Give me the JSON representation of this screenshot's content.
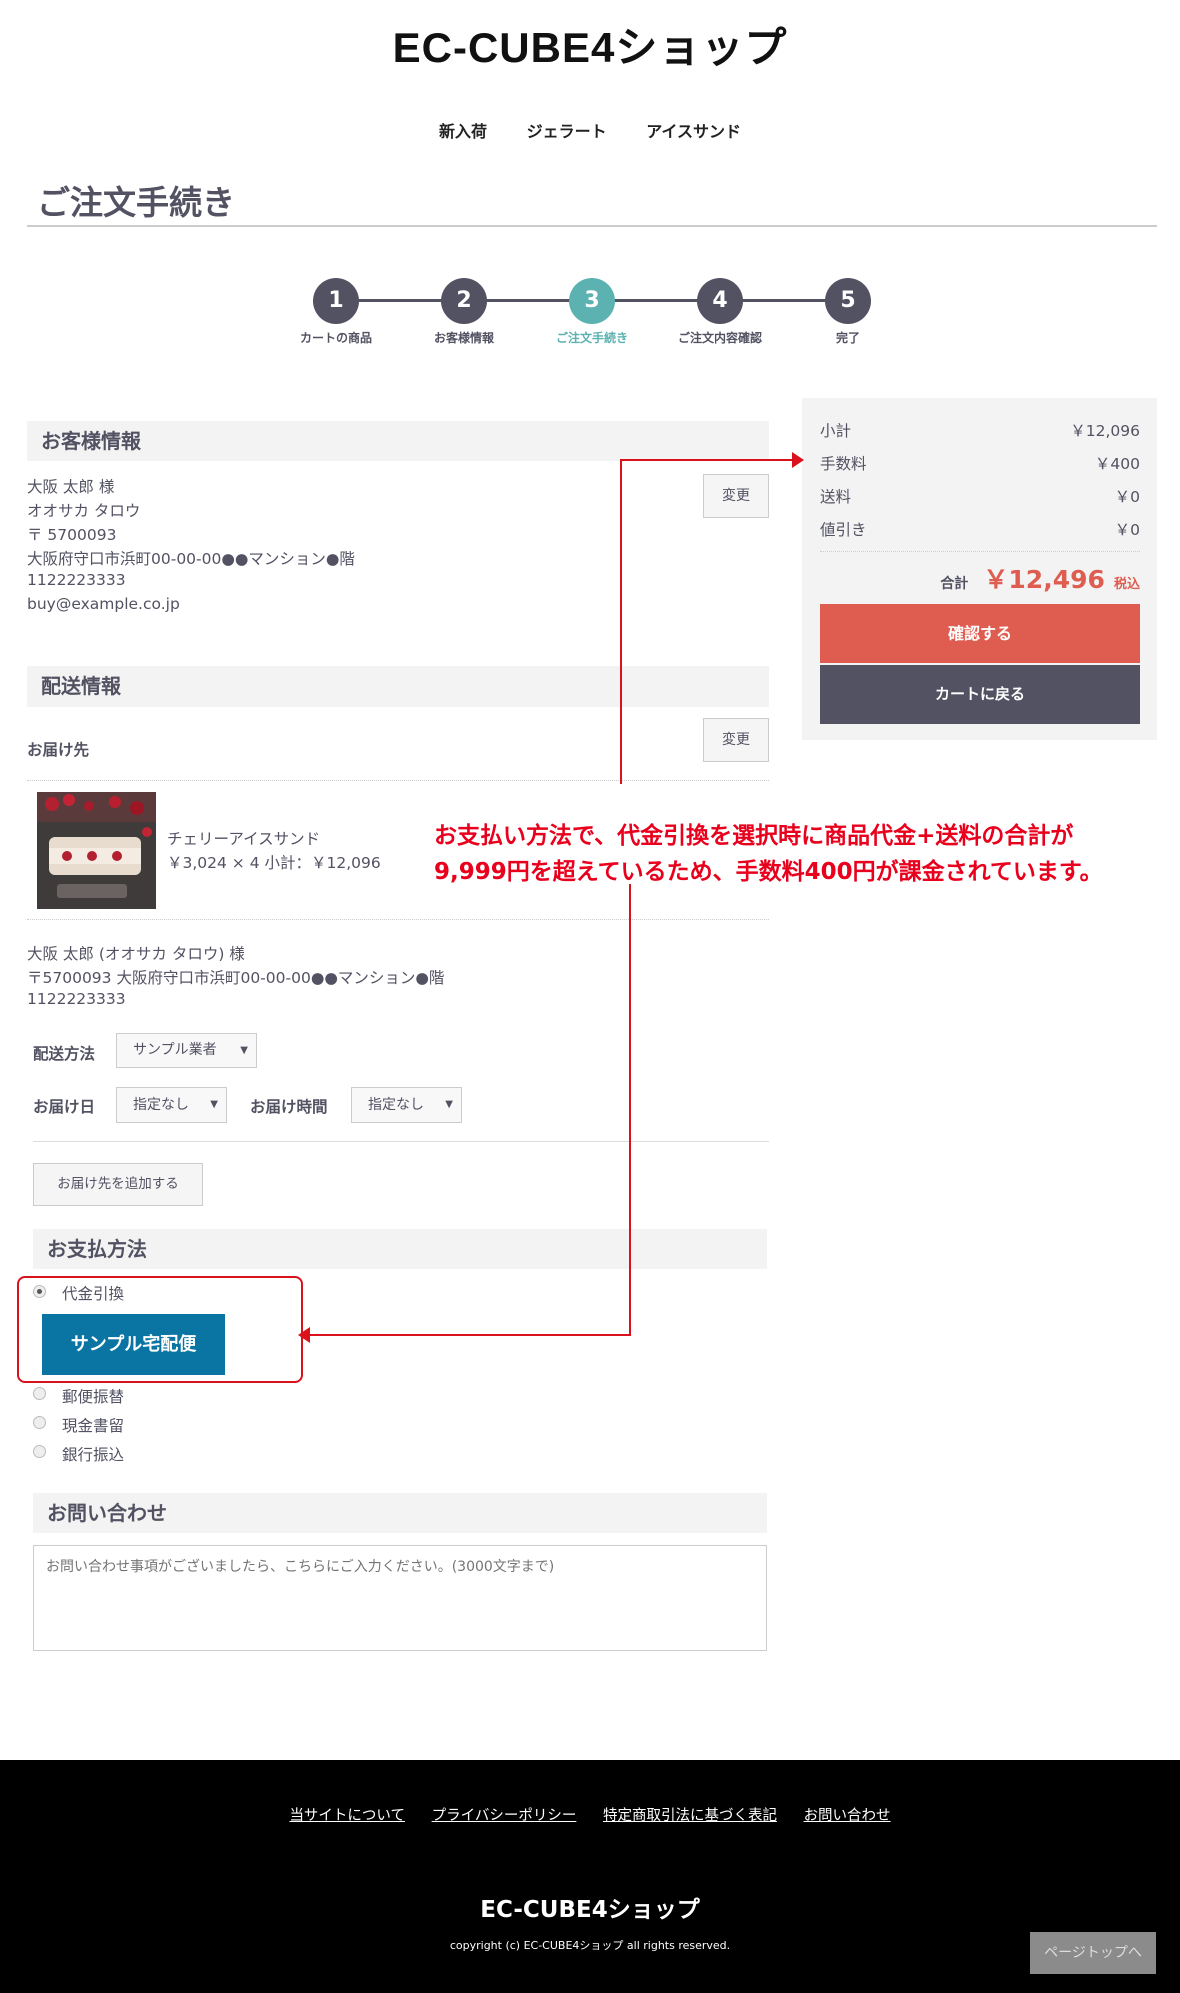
{
  "site": {
    "title": "EC-CUBE4ショップ"
  },
  "nav": {
    "items": [
      "新入荷",
      "ジェラート",
      "アイスサンド"
    ]
  },
  "page": {
    "heading": "ご注文手続き"
  },
  "steps": [
    {
      "num": "1",
      "label": "カートの商品"
    },
    {
      "num": "2",
      "label": "お客様情報"
    },
    {
      "num": "3",
      "label": "ご注文手続き"
    },
    {
      "num": "4",
      "label": "ご注文内容確認"
    },
    {
      "num": "5",
      "label": "完了"
    }
  ],
  "customer": {
    "heading": "お客様情報",
    "name": "大阪 太郎 様",
    "kana": "オオサカ タロウ",
    "zip": "〒 5700093",
    "address": "大阪府守口市浜町00-00-00●●マンション●階",
    "phone": "1122223333",
    "email": "buy@example.co.jp",
    "change_label": "変更"
  },
  "shipping": {
    "heading": "配送情報",
    "dest_label": "お届け先",
    "change_label": "変更",
    "product_name": "チェリーアイスサンド",
    "product_price": "￥3,024 × 4  小計：￥12,096",
    "recipient": "大阪 太郎 (オオサカ タロウ) 様",
    "recipient_address": "〒5700093 大阪府守口市浜町00-00-00●●マンション●階",
    "recipient_phone": "1122223333",
    "method_label": "配送方法",
    "method_value": "サンプル業者",
    "date_label": "お届け日",
    "date_value": "指定なし",
    "time_label": "お届け時間",
    "time_value": "指定なし",
    "add_dest_label": "お届け先を追加する"
  },
  "payment": {
    "heading": "お支払方法",
    "options": [
      "代金引換",
      "郵便振替",
      "現金書留",
      "銀行振込"
    ],
    "tooltip": "サンプル宅配便"
  },
  "inquiry": {
    "heading": "お問い合わせ",
    "placeholder": "お問い合わせ事項がございましたら、こちらにご入力ください。(3000文字まで)"
  },
  "summary": {
    "subtotal_label": "小計",
    "subtotal": "￥12,096",
    "fee_label": "手数料",
    "fee": "￥400",
    "shipping_label": "送料",
    "shipping": "￥0",
    "discount_label": "値引き",
    "discount": "￥0",
    "total_label": "合計",
    "total": "￥12,496",
    "tax_label": "税込",
    "confirm_label": "確認する",
    "back_label": "カートに戻る"
  },
  "annotation": {
    "line1": "お支払い方法で、代金引換を選択時に商品代金+送料の合計が",
    "line2": "9,999円を超えているため、手数料400円が課金されています。"
  },
  "footer": {
    "links": [
      "当サイトについて",
      "プライバシーポリシー",
      "特定商取引法に基づく表記",
      "お問い合わせ"
    ],
    "title": "EC-CUBE4ショップ",
    "copyright": "copyright (c) EC-CUBE4ショップ all rights reserved.",
    "pagetop": "ページトップへ"
  },
  "colors": {
    "accent": "#5cb1b1",
    "confirm": "#de5d50",
    "dark": "#525263",
    "annotation": "#e8001c",
    "tooltip": "#0a75a3"
  }
}
